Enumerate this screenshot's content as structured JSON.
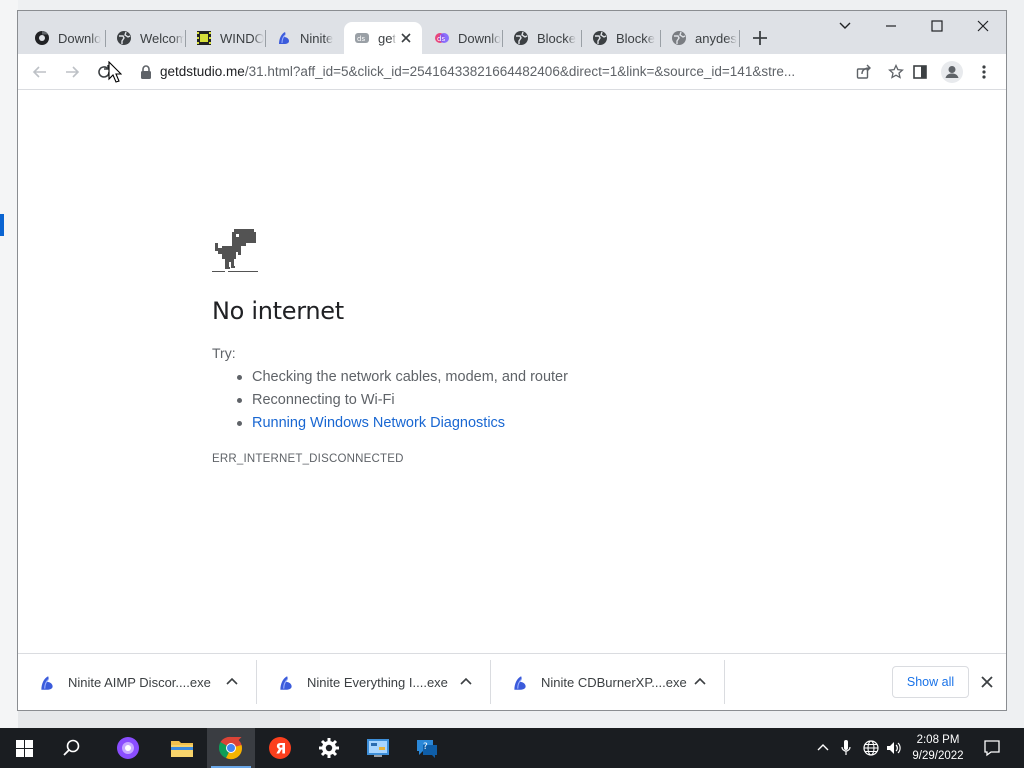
{
  "browser": {
    "tabs": [
      {
        "label": "Downlo",
        "icon": "chrome-dark-icon"
      },
      {
        "label": "Welcom",
        "icon": "globe-icon"
      },
      {
        "label": "WINDO",
        "icon": "film-icon"
      },
      {
        "label": "Ninite",
        "icon": "ninite-icon"
      },
      {
        "label": "get",
        "icon": "getdstudio-icon",
        "active": true
      },
      {
        "label": "Downlo",
        "icon": "getdstudio-icon"
      },
      {
        "label": "Blocke",
        "icon": "globe-icon"
      },
      {
        "label": "Blocke",
        "icon": "globe-icon"
      },
      {
        "label": "anydes",
        "icon": "globe-icon"
      }
    ],
    "url_host": "getdstudio.me",
    "url_path": "/31.html?aff_id=5&click_id=25416433821664482406&direct=1&link=&source_id=141&stre..."
  },
  "page": {
    "title": "No internet",
    "try_label": "Try:",
    "suggestions": [
      "Checking the network cables, modem, and router",
      "Reconnecting to Wi-Fi",
      "Running Windows Network Diagnostics"
    ],
    "error_code": "ERR_INTERNET_DISCONNECTED"
  },
  "downloads": {
    "items": [
      {
        "name": "Ninite AIMP Discor....exe"
      },
      {
        "name": "Ninite Everything I....exe"
      },
      {
        "name": "Ninite CDBurnerXP....exe"
      }
    ],
    "show_all": "Show all"
  },
  "taskbar": {
    "time": "2:08 PM",
    "date": "9/29/2022"
  },
  "colors": {
    "accent": "#1a73e8",
    "link": "#1967d2",
    "tabstrip": "#dee1e6",
    "taskbar": "#1a1d21"
  }
}
